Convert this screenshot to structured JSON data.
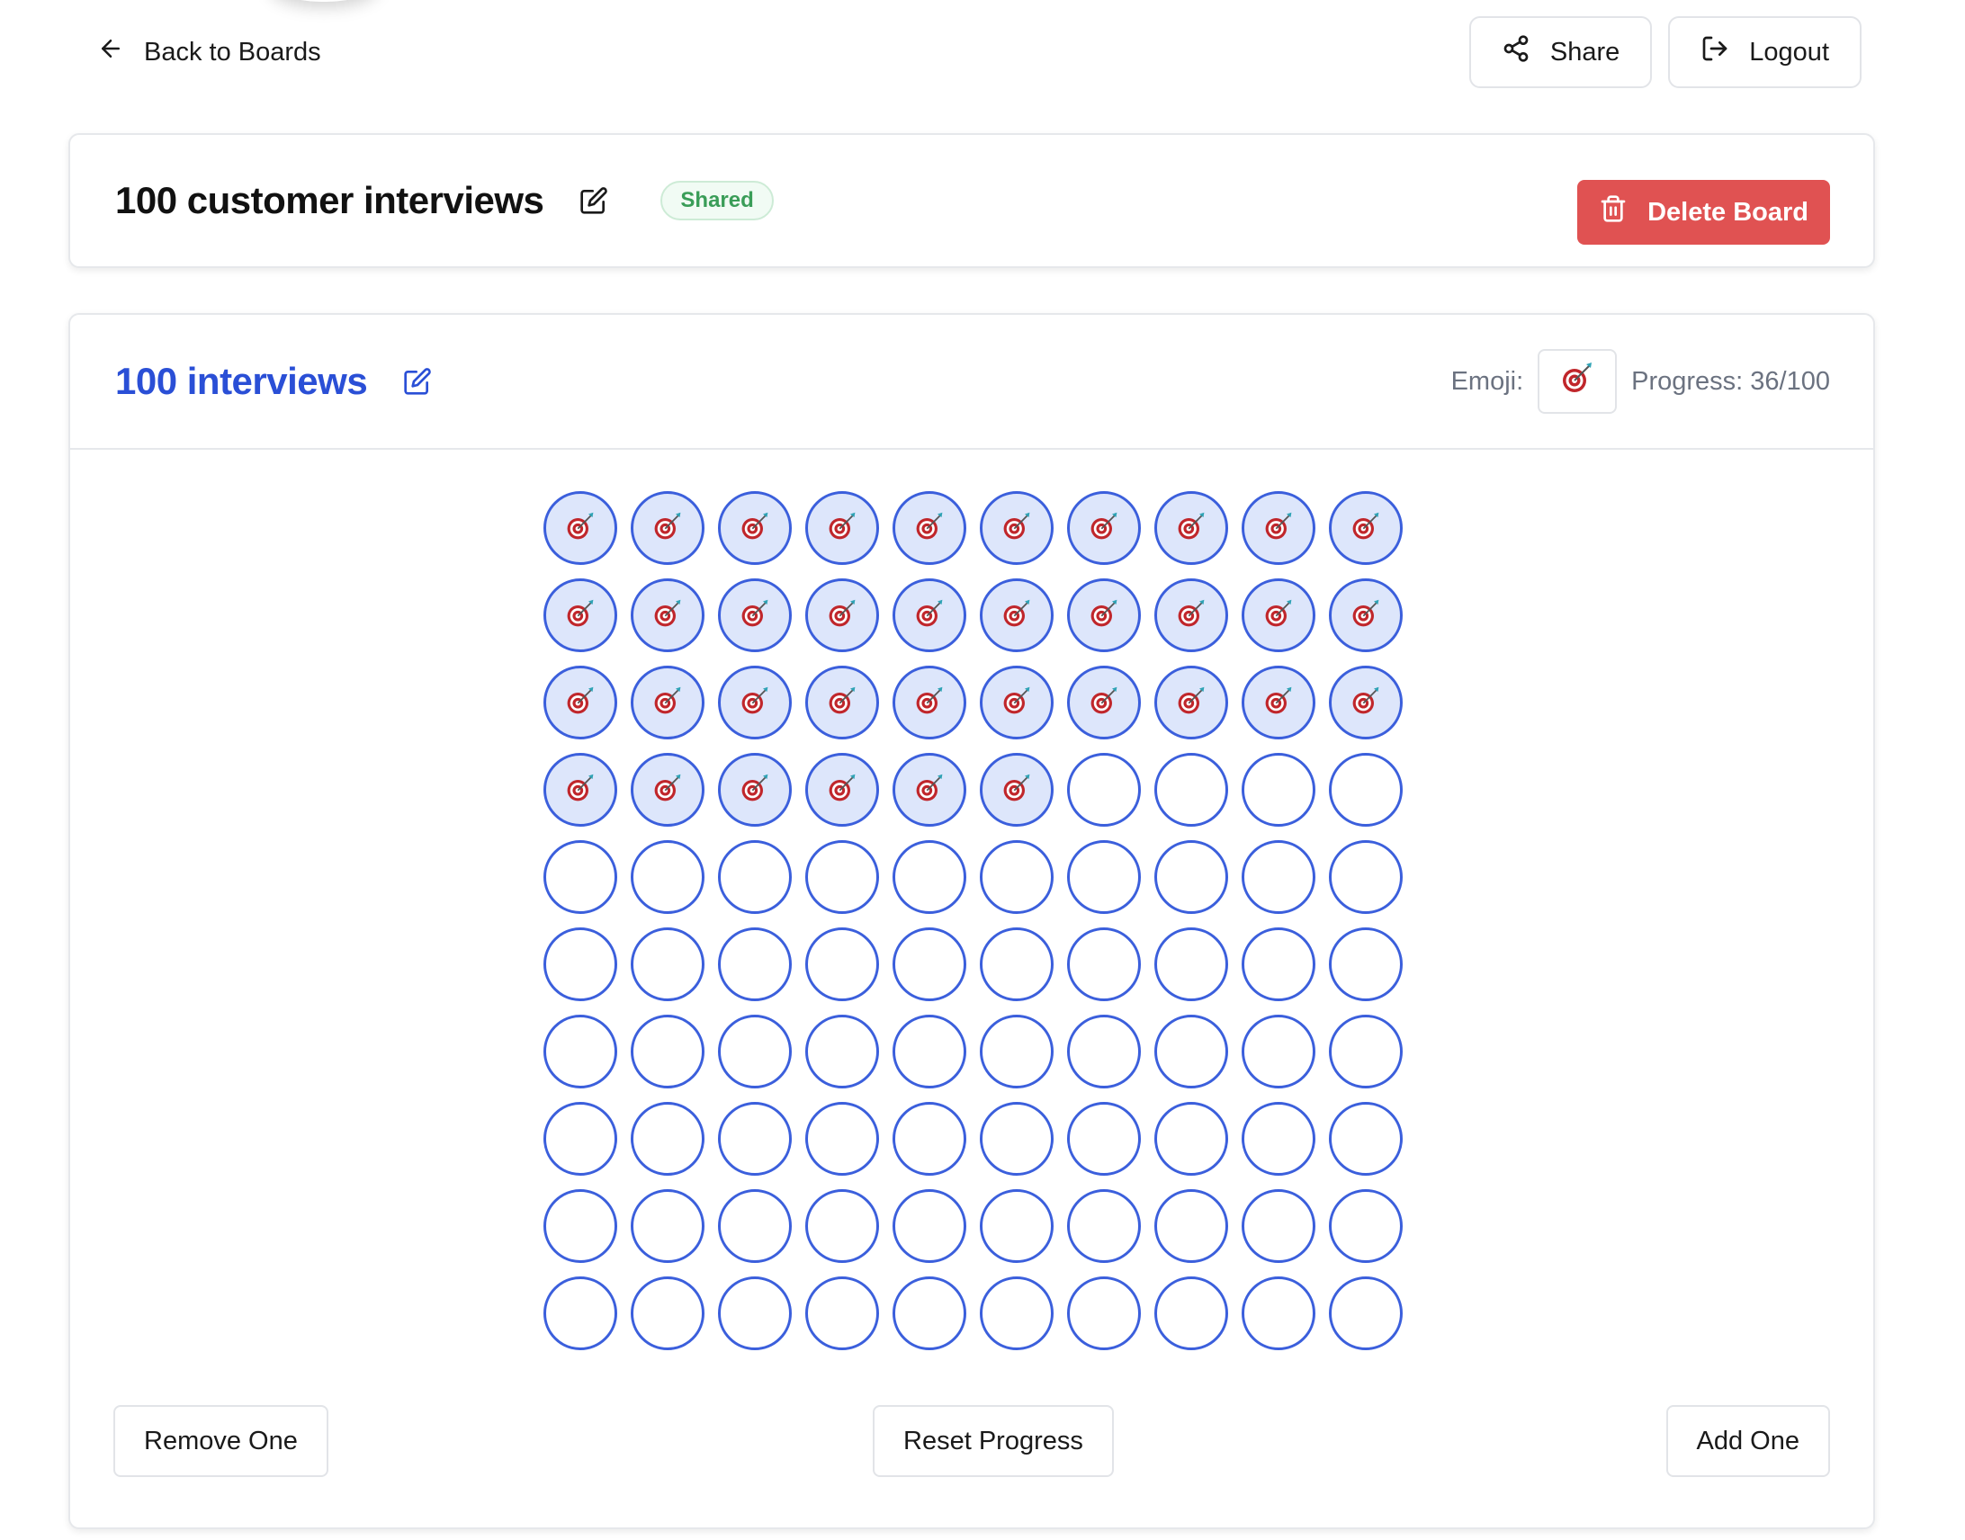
{
  "nav": {
    "back_label": "Back to Boards",
    "share_label": "Share",
    "logout_label": "Logout"
  },
  "board": {
    "title": "100 customer interviews",
    "badge": "Shared",
    "delete_label": "Delete Board"
  },
  "goal": {
    "title": "100 interviews",
    "emoji_label": "Emoji:",
    "emoji_icon": "dart-target-emoji",
    "progress_label": "Progress: 36/100",
    "progress": 36,
    "total": 100
  },
  "actions": {
    "remove_label": "Remove One",
    "reset_label": "Reset Progress",
    "add_label": "Add One"
  },
  "colors": {
    "accent": "#3b5fdc",
    "title_blue": "#2a4fd6",
    "danger": "#e05252",
    "success": "#3a9d58",
    "filled_bg": "#dde6fb"
  },
  "icons": {
    "back": "arrow-left-icon",
    "share": "share-icon",
    "logout": "logout-icon",
    "edit": "edit-icon",
    "delete": "trash-icon"
  }
}
